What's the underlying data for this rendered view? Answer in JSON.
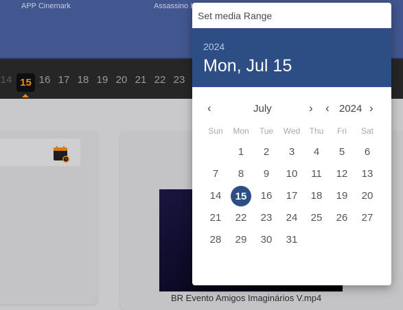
{
  "background": {
    "top_labels": [
      "APP Cinemark",
      "Assassino I"
    ],
    "day_strip": {
      "days": [
        "14",
        "15",
        "16",
        "17",
        "18",
        "19",
        "20",
        "21",
        "22",
        "23"
      ],
      "selected": "15"
    },
    "card_icon": "calendar-clock-icon",
    "video_caption": "BR Evento Amigos Imaginários V.mp4"
  },
  "date_picker": {
    "title": "Set media Range",
    "header_year": "2024",
    "header_date": "Mon, Jul 15",
    "month_label": "July",
    "year_label": "2024",
    "weekdays": [
      "Sun",
      "Mon",
      "Tue",
      "Wed",
      "Thu",
      "Fri",
      "Sat"
    ],
    "weeks": [
      [
        "",
        "1",
        "2",
        "3",
        "4",
        "5",
        "6"
      ],
      [
        "7",
        "8",
        "9",
        "10",
        "11",
        "12",
        "13"
      ],
      [
        "14",
        "15",
        "16",
        "17",
        "18",
        "19",
        "20"
      ],
      [
        "21",
        "22",
        "23",
        "24",
        "25",
        "26",
        "27"
      ],
      [
        "28",
        "29",
        "30",
        "31",
        "",
        "",
        ""
      ]
    ],
    "selected_day": "15",
    "colors": {
      "accent": "#2c4e85",
      "strip_highlight": "#e88a1c"
    }
  }
}
